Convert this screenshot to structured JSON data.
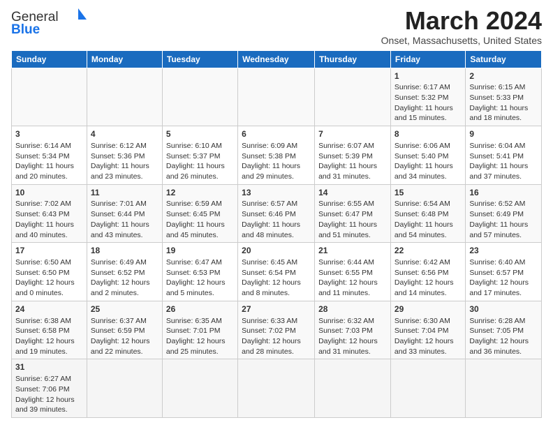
{
  "logo": {
    "line1": "General",
    "line2": "Blue"
  },
  "title": "March 2024",
  "subtitle": "Onset, Massachusetts, United States",
  "days": [
    "Sunday",
    "Monday",
    "Tuesday",
    "Wednesday",
    "Thursday",
    "Friday",
    "Saturday"
  ],
  "weeks": [
    [
      {
        "num": "",
        "info": ""
      },
      {
        "num": "",
        "info": ""
      },
      {
        "num": "",
        "info": ""
      },
      {
        "num": "",
        "info": ""
      },
      {
        "num": "",
        "info": ""
      },
      {
        "num": "1",
        "info": "Sunrise: 6:17 AM\nSunset: 5:32 PM\nDaylight: 11 hours and 15 minutes."
      },
      {
        "num": "2",
        "info": "Sunrise: 6:15 AM\nSunset: 5:33 PM\nDaylight: 11 hours and 18 minutes."
      }
    ],
    [
      {
        "num": "3",
        "info": "Sunrise: 6:14 AM\nSunset: 5:34 PM\nDaylight: 11 hours and 20 minutes."
      },
      {
        "num": "4",
        "info": "Sunrise: 6:12 AM\nSunset: 5:36 PM\nDaylight: 11 hours and 23 minutes."
      },
      {
        "num": "5",
        "info": "Sunrise: 6:10 AM\nSunset: 5:37 PM\nDaylight: 11 hours and 26 minutes."
      },
      {
        "num": "6",
        "info": "Sunrise: 6:09 AM\nSunset: 5:38 PM\nDaylight: 11 hours and 29 minutes."
      },
      {
        "num": "7",
        "info": "Sunrise: 6:07 AM\nSunset: 5:39 PM\nDaylight: 11 hours and 31 minutes."
      },
      {
        "num": "8",
        "info": "Sunrise: 6:06 AM\nSunset: 5:40 PM\nDaylight: 11 hours and 34 minutes."
      },
      {
        "num": "9",
        "info": "Sunrise: 6:04 AM\nSunset: 5:41 PM\nDaylight: 11 hours and 37 minutes."
      }
    ],
    [
      {
        "num": "10",
        "info": "Sunrise: 7:02 AM\nSunset: 6:43 PM\nDaylight: 11 hours and 40 minutes."
      },
      {
        "num": "11",
        "info": "Sunrise: 7:01 AM\nSunset: 6:44 PM\nDaylight: 11 hours and 43 minutes."
      },
      {
        "num": "12",
        "info": "Sunrise: 6:59 AM\nSunset: 6:45 PM\nDaylight: 11 hours and 45 minutes."
      },
      {
        "num": "13",
        "info": "Sunrise: 6:57 AM\nSunset: 6:46 PM\nDaylight: 11 hours and 48 minutes."
      },
      {
        "num": "14",
        "info": "Sunrise: 6:55 AM\nSunset: 6:47 PM\nDaylight: 11 hours and 51 minutes."
      },
      {
        "num": "15",
        "info": "Sunrise: 6:54 AM\nSunset: 6:48 PM\nDaylight: 11 hours and 54 minutes."
      },
      {
        "num": "16",
        "info": "Sunrise: 6:52 AM\nSunset: 6:49 PM\nDaylight: 11 hours and 57 minutes."
      }
    ],
    [
      {
        "num": "17",
        "info": "Sunrise: 6:50 AM\nSunset: 6:50 PM\nDaylight: 12 hours and 0 minutes."
      },
      {
        "num": "18",
        "info": "Sunrise: 6:49 AM\nSunset: 6:52 PM\nDaylight: 12 hours and 2 minutes."
      },
      {
        "num": "19",
        "info": "Sunrise: 6:47 AM\nSunset: 6:53 PM\nDaylight: 12 hours and 5 minutes."
      },
      {
        "num": "20",
        "info": "Sunrise: 6:45 AM\nSunset: 6:54 PM\nDaylight: 12 hours and 8 minutes."
      },
      {
        "num": "21",
        "info": "Sunrise: 6:44 AM\nSunset: 6:55 PM\nDaylight: 12 hours and 11 minutes."
      },
      {
        "num": "22",
        "info": "Sunrise: 6:42 AM\nSunset: 6:56 PM\nDaylight: 12 hours and 14 minutes."
      },
      {
        "num": "23",
        "info": "Sunrise: 6:40 AM\nSunset: 6:57 PM\nDaylight: 12 hours and 17 minutes."
      }
    ],
    [
      {
        "num": "24",
        "info": "Sunrise: 6:38 AM\nSunset: 6:58 PM\nDaylight: 12 hours and 19 minutes."
      },
      {
        "num": "25",
        "info": "Sunrise: 6:37 AM\nSunset: 6:59 PM\nDaylight: 12 hours and 22 minutes."
      },
      {
        "num": "26",
        "info": "Sunrise: 6:35 AM\nSunset: 7:01 PM\nDaylight: 12 hours and 25 minutes."
      },
      {
        "num": "27",
        "info": "Sunrise: 6:33 AM\nSunset: 7:02 PM\nDaylight: 12 hours and 28 minutes."
      },
      {
        "num": "28",
        "info": "Sunrise: 6:32 AM\nSunset: 7:03 PM\nDaylight: 12 hours and 31 minutes."
      },
      {
        "num": "29",
        "info": "Sunrise: 6:30 AM\nSunset: 7:04 PM\nDaylight: 12 hours and 33 minutes."
      },
      {
        "num": "30",
        "info": "Sunrise: 6:28 AM\nSunset: 7:05 PM\nDaylight: 12 hours and 36 minutes."
      }
    ],
    [
      {
        "num": "31",
        "info": "Sunrise: 6:27 AM\nSunset: 7:06 PM\nDaylight: 12 hours and 39 minutes."
      },
      {
        "num": "",
        "info": ""
      },
      {
        "num": "",
        "info": ""
      },
      {
        "num": "",
        "info": ""
      },
      {
        "num": "",
        "info": ""
      },
      {
        "num": "",
        "info": ""
      },
      {
        "num": "",
        "info": ""
      }
    ]
  ]
}
